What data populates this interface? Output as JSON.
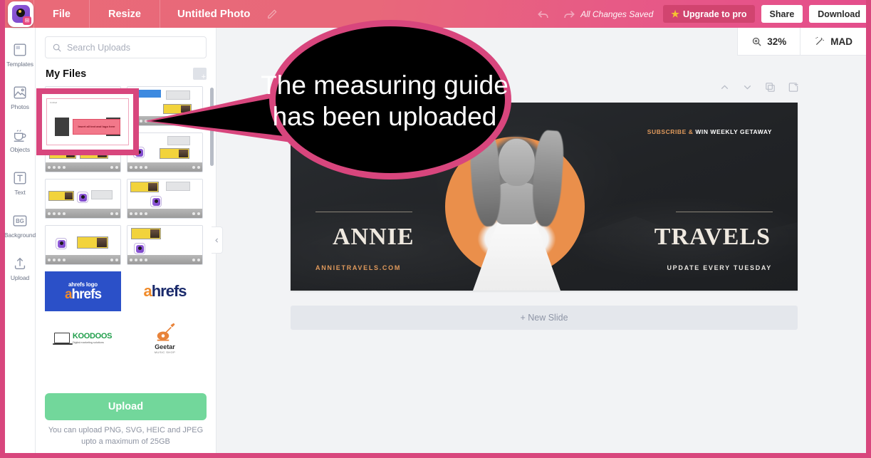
{
  "topbar": {
    "menu": [
      {
        "label": "File",
        "name": "menu-file"
      },
      {
        "label": "Resize",
        "name": "menu-resize"
      }
    ],
    "doc_title": "Untitled Photo",
    "saved_status": "All Changes Saved",
    "upgrade_label": "Upgrade to pro",
    "share_label": "Share",
    "download_label": "Download"
  },
  "zoombar": {
    "zoom_level": "32%",
    "mad_label": "MAD"
  },
  "rail": {
    "items": [
      {
        "label": "Templates",
        "icon": "templates-icon"
      },
      {
        "label": "Photos",
        "icon": "photos-icon"
      },
      {
        "label": "Objects",
        "icon": "objects-icon"
      },
      {
        "label": "Text",
        "icon": "text-icon"
      },
      {
        "label": "Background",
        "icon": "background-icon"
      },
      {
        "label": "Upload",
        "icon": "upload-icon"
      }
    ]
  },
  "panel": {
    "search_placeholder": "Search Uploads",
    "search_value": "",
    "title": "My Files",
    "upload_button": "Upload",
    "upload_hint": "You can upload PNG, SVG, HEIC and JPEG upto a maximum of 25GB",
    "logos": {
      "ahrefs_caption": "ahrefs logo",
      "ahrefs_name": "ahrefs",
      "koodoos_name": "KOODOOS",
      "koodoos_tag": "Digital marketing solutions",
      "geetar_name": "Geetar",
      "geetar_tag": "MUSIC SHOP"
    },
    "highlighted_thumb": {
      "tag": "Untitled",
      "body": "Insert all text and logo here"
    }
  },
  "callout": {
    "line1": "The measuring guide",
    "line2": "has been uploaded",
    "bubble_color": "#d8467d",
    "fill_color": "#000000"
  },
  "canvas": {
    "subscribe_prefix": "SUBSCRIBE &",
    "subscribe_suffix": " WIN WEEKLY GETAWAY",
    "left_word": "ANNIE",
    "right_word": "TRAVELS",
    "website": "ANNIETRAVELS.COM",
    "update_text": "UPDATE EVERY TUESDAY",
    "bg_color": "#24262a",
    "accent_color": "#ea8f4b"
  },
  "editor": {
    "new_slide_label": "+ New Slide"
  }
}
